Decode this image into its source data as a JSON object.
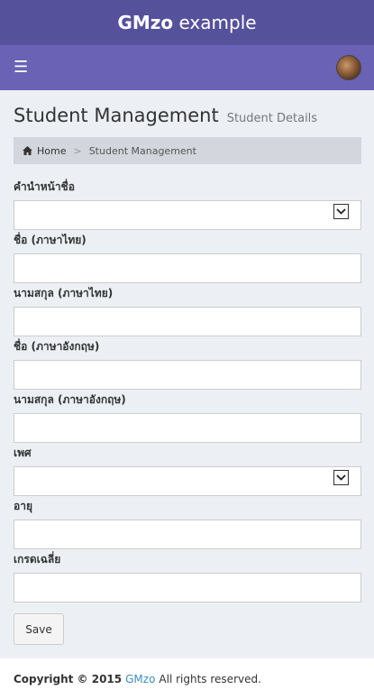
{
  "header": {
    "brand_bold": "GMzo",
    "brand_rest": " example"
  },
  "navbar": {
    "menu_icon": "hamburger-icon",
    "avatar_icon": "user-avatar"
  },
  "page": {
    "title": "Student Management",
    "subtitle": "Student Details"
  },
  "breadcrumb": {
    "home_icon": "home-icon",
    "home": "Home",
    "separator": ">",
    "current": "Student Management"
  },
  "form": {
    "fields": [
      {
        "label": "คำนำหน้าชื่อ",
        "type": "select",
        "value": ""
      },
      {
        "label": "ชื่อ (ภาษาไทย)",
        "type": "text",
        "value": ""
      },
      {
        "label": "นามสกุล (ภาษาไทย)",
        "type": "text",
        "value": ""
      },
      {
        "label": "ชื่อ (ภาษาอังกฤษ)",
        "type": "text",
        "value": ""
      },
      {
        "label": "นามสกุล (ภาษาอังกฤษ)",
        "type": "text",
        "value": ""
      },
      {
        "label": "เพศ",
        "type": "select",
        "value": ""
      },
      {
        "label": "อายุ",
        "type": "text",
        "value": ""
      },
      {
        "label": "เกรดเฉลี่ย",
        "type": "text",
        "value": ""
      }
    ],
    "save_label": "Save"
  },
  "footer": {
    "copyright": "Copyright © 2015",
    "link": "GMzo",
    "rights": "All rights reserved."
  },
  "colors": {
    "topbar": "#55519b",
    "navbar": "#6a62b4",
    "background": "#ecf0f5",
    "link": "#3c8dbc"
  }
}
